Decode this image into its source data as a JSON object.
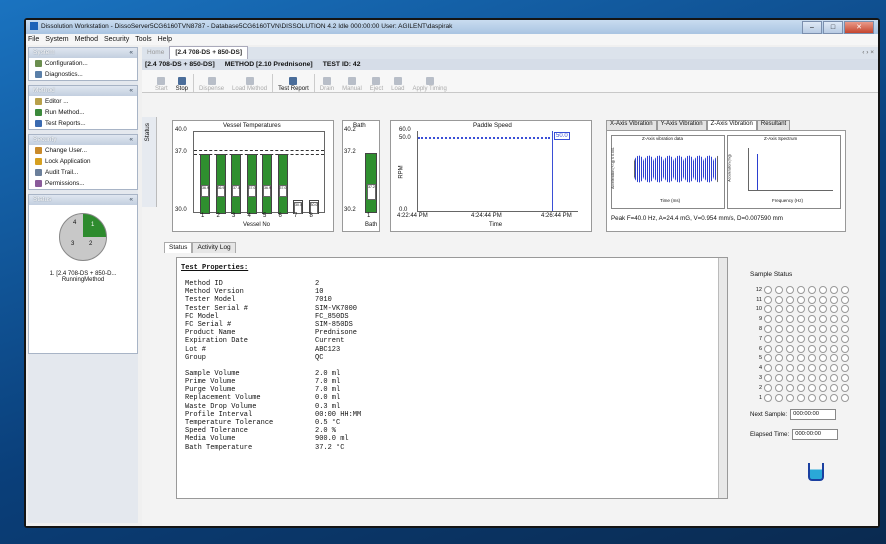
{
  "window": {
    "title": "Dissolution Workstation - DissoServer5CG6160TVN8787 - Database5CG6160TVN\\DISSOLUTION 4.2   Idle 000:00:00  User: AGILENT\\daspirak"
  },
  "menubar": [
    "File",
    "System",
    "Method",
    "Security",
    "Tools",
    "Help"
  ],
  "sidebar": {
    "system": {
      "title": "System",
      "items": [
        "Configuration...",
        "Diagnostics..."
      ]
    },
    "method": {
      "title": "Method",
      "items": [
        "Editor ...",
        "Run Method...",
        "Test Reports..."
      ]
    },
    "security": {
      "title": "Security",
      "items": [
        "Change User...",
        "Lock Application",
        "Audit Trail...",
        "Permissions..."
      ]
    },
    "status": {
      "title": "Status",
      "pie_labels": [
        "4",
        "3",
        "2",
        "1"
      ],
      "run_line1": "1. [2.4 708-DS + 850-D...",
      "run_line2": "RunningMethod"
    }
  },
  "tabs": {
    "home": "Home",
    "active": "[2.4 708-DS + 850-DS]",
    "close": "‹ › ×"
  },
  "idbar": {
    "system": "[2.4 708-DS + 850-DS]",
    "method": "METHOD [2.10 Prednisone]",
    "test": "TEST ID: 42"
  },
  "toolbar": [
    {
      "label": "Start",
      "enabled": false
    },
    {
      "label": "Stop",
      "enabled": true
    },
    {
      "label": "Dispense",
      "enabled": false
    },
    {
      "label": "Load Method",
      "enabled": false
    },
    {
      "label": "Test Report",
      "enabled": true
    },
    {
      "label": "Drain",
      "enabled": false
    },
    {
      "label": "Manual",
      "enabled": false
    },
    {
      "label": "Eject",
      "enabled": false
    },
    {
      "label": "Load",
      "enabled": false
    },
    {
      "label": "Apply Timing",
      "enabled": false
    }
  ],
  "status_side_label": "Status",
  "vessel_temps": {
    "title": "Vessel Temperatures",
    "xlabel": "Vessel No",
    "ymax": "40.0",
    "ymid": "37.0",
    "ymin": "30.0",
    "vessels": [
      "1",
      "2",
      "3",
      "4",
      "5",
      "6",
      "7",
      "8"
    ],
    "active_vessels": [
      true,
      true,
      true,
      true,
      true,
      true,
      false,
      false
    ],
    "fill_fraction": 0.72,
    "readings": [
      "36.9",
      "36.9",
      "37.0",
      "37.0",
      "36.9",
      "37.0",
      "30.0",
      "30.0"
    ]
  },
  "bath": {
    "title": "Bath",
    "ymax": "40.2",
    "ymid": "37.2",
    "ymin": "30.2",
    "xlabel": "Bath",
    "tick": "1",
    "reading": "37.2",
    "fill_fraction": 0.72
  },
  "paddle": {
    "title": "Paddle Speed",
    "ylabel": "RPM",
    "yticks": [
      "60.0",
      "50.0",
      "0.0"
    ],
    "xticks": [
      "4:22:44 PM",
      "4:24:44 PM",
      "4:26:44 PM"
    ],
    "xlabel": "Time",
    "value": "50.0"
  },
  "vibration": {
    "tabs": [
      "X-Axis Vibration",
      "Y-Axis Vibration",
      "Z-Axis Vibration",
      "Resultant"
    ],
    "active_tab": 2,
    "left_title": "Z-Axis vibration data",
    "right_title": "Z-Axis Spectrum",
    "left_ylabel": "Acceleration (+/-g) X 0.001",
    "right_ylabel": "Acceleration (mg)",
    "left_xlabel": "Time (ms)",
    "right_xlabel": "Frequency (Hz)",
    "summary": "Peak F=40.0 Hz, A=24.4 mG, V=0.954 mm/s, D=0.007590 mm"
  },
  "content_tabs": [
    "Status",
    "Activity Log"
  ],
  "test_properties": {
    "heading": "Test Properties:",
    "group1": [
      [
        "Method ID",
        "2"
      ],
      [
        "Method Version",
        "10"
      ],
      [
        "Tester Model",
        "7010"
      ],
      [
        "Tester Serial #",
        "SIM-VK7000"
      ],
      [
        "FC Model",
        "FC_850DS"
      ],
      [
        "FC Serial #",
        "SIM-850DS"
      ],
      [
        "Product Name",
        "Prednisone"
      ],
      [
        "Expiration Date",
        "Current"
      ],
      [
        "Lot #",
        "ABC123"
      ],
      [
        "Group",
        "QC"
      ]
    ],
    "group2": [
      [
        "Sample Volume",
        "2.0 ml"
      ],
      [
        "Prime Volume",
        "7.0 ml"
      ],
      [
        "Purge Volume",
        "7.0 ml"
      ],
      [
        "Replacement Volume",
        "0.0 ml"
      ],
      [
        "Waste Drop Volume",
        "0.3 ml"
      ],
      [
        "Profile Interval",
        "00:00 HH:MM"
      ],
      [
        "Temperature Tolerance",
        "0.5 °C"
      ],
      [
        "Speed Tolerance",
        "2.0 %"
      ],
      [
        "Media Volume",
        "900.0 ml"
      ],
      [
        "Bath Temperature",
        "37.2 °C"
      ]
    ]
  },
  "sample_status": {
    "title": "Sample Status",
    "rows": [
      "12",
      "11",
      "10",
      "9",
      "8",
      "7",
      "6",
      "5",
      "4",
      "3",
      "2",
      "1"
    ],
    "next_label": "Next Sample:",
    "next_value": "000:00:00",
    "elapsed_label": "Elapsed Time:",
    "elapsed_value": "000:00:00"
  },
  "colors": {
    "vessel_fill": "#2f8f2f",
    "pie_active": "#2e8b2e",
    "paddle_line": "#3a4fd6",
    "wave": "#2b3fd0"
  }
}
